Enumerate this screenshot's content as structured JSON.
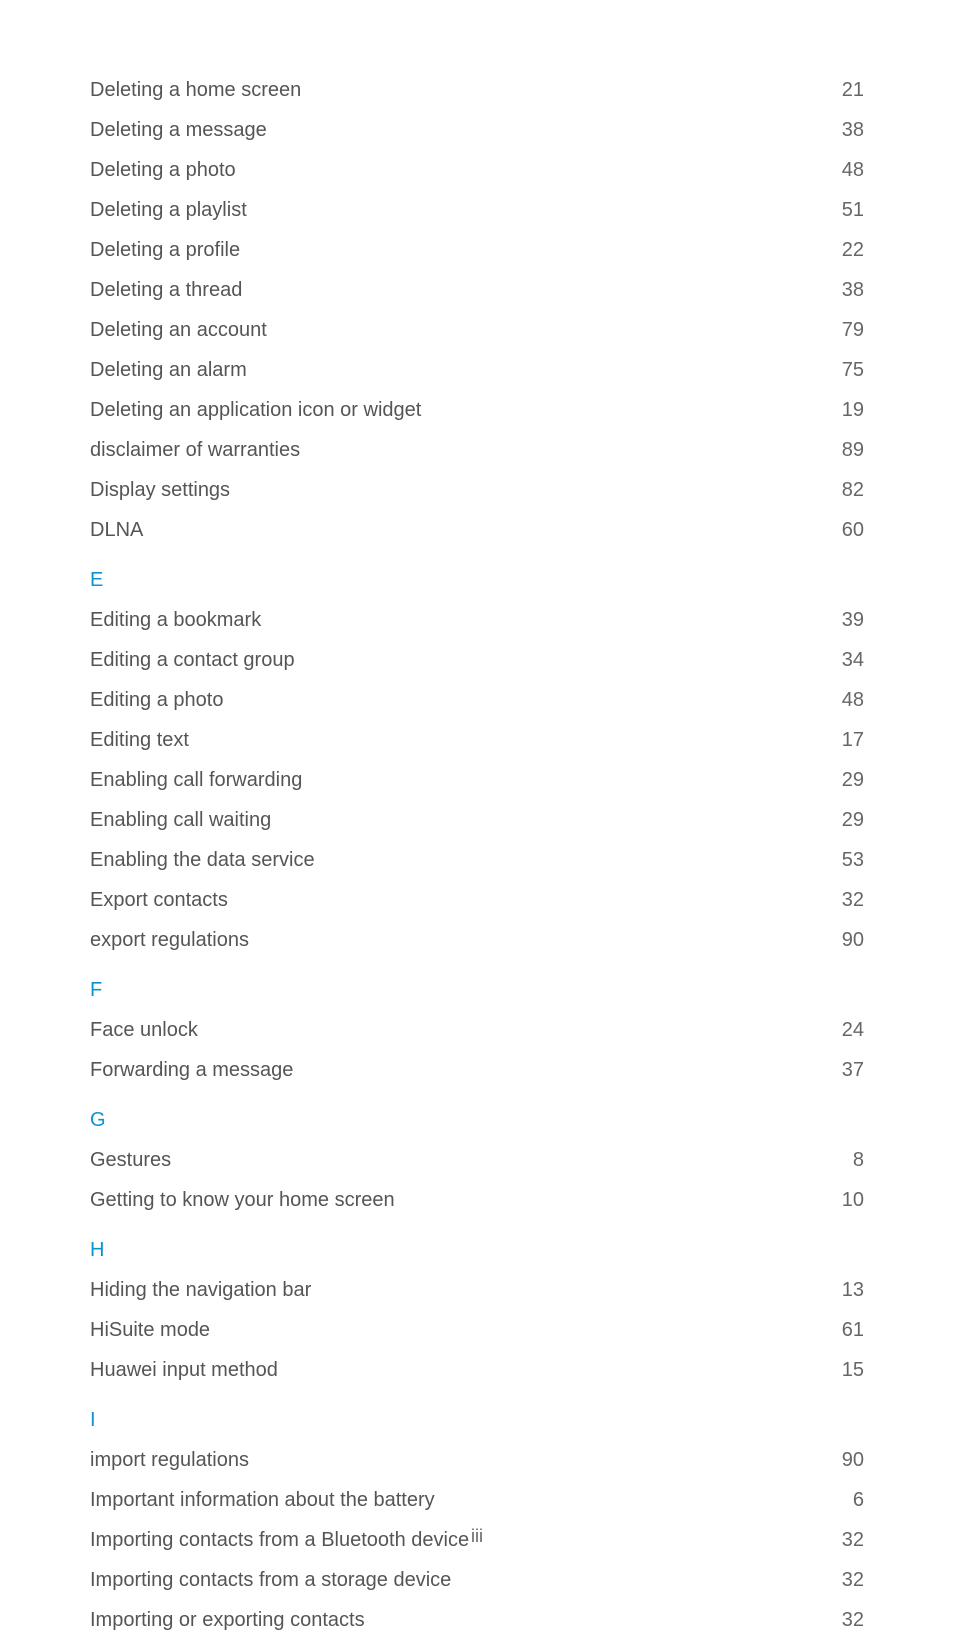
{
  "sections": [
    {
      "letter": null,
      "entries": [
        {
          "label": "Deleting a home screen",
          "page": "21"
        },
        {
          "label": "Deleting a message",
          "page": "38"
        },
        {
          "label": "Deleting a photo",
          "page": "48"
        },
        {
          "label": "Deleting a playlist",
          "page": "51"
        },
        {
          "label": "Deleting a profile",
          "page": "22"
        },
        {
          "label": "Deleting a thread",
          "page": "38"
        },
        {
          "label": "Deleting an account",
          "page": "79"
        },
        {
          "label": "Deleting an alarm",
          "page": "75"
        },
        {
          "label": "Deleting an application icon or widget",
          "page": "19"
        },
        {
          "label": "disclaimer of warranties",
          "page": "89"
        },
        {
          "label": "Display settings",
          "page": "82"
        },
        {
          "label": "DLNA",
          "page": "60"
        }
      ]
    },
    {
      "letter": "E",
      "entries": [
        {
          "label": "Editing a bookmark",
          "page": "39"
        },
        {
          "label": "Editing a contact group",
          "page": "34"
        },
        {
          "label": "Editing a photo",
          "page": "48"
        },
        {
          "label": "Editing text",
          "page": "17"
        },
        {
          "label": "Enabling call forwarding",
          "page": "29"
        },
        {
          "label": "Enabling call waiting",
          "page": "29"
        },
        {
          "label": "Enabling the data service",
          "page": "53"
        },
        {
          "label": "Export contacts",
          "page": "32"
        },
        {
          "label": "export regulations",
          "page": "90"
        }
      ]
    },
    {
      "letter": "F",
      "entries": [
        {
          "label": "Face unlock",
          "page": "24"
        },
        {
          "label": "Forwarding a message",
          "page": "37"
        }
      ]
    },
    {
      "letter": "G",
      "entries": [
        {
          "label": "Gestures",
          "page": "8"
        },
        {
          "label": "Getting to know your home screen",
          "page": "10"
        }
      ]
    },
    {
      "letter": "H",
      "entries": [
        {
          "label": "Hiding the navigation bar",
          "page": "13"
        },
        {
          "label": "HiSuite mode",
          "page": "61"
        },
        {
          "label": "Huawei input method",
          "page": "15"
        }
      ]
    },
    {
      "letter": "I",
      "entries": [
        {
          "label": "import regulations",
          "page": "90"
        },
        {
          "label": "Important information about the battery",
          "page": "6"
        },
        {
          "label": "Importing contacts from a Bluetooth device",
          "page": "32"
        },
        {
          "label": "Importing contacts from a storage device",
          "page": "32"
        },
        {
          "label": "Importing or exporting contacts",
          "page": "32"
        }
      ]
    }
  ],
  "page_number": "iii"
}
